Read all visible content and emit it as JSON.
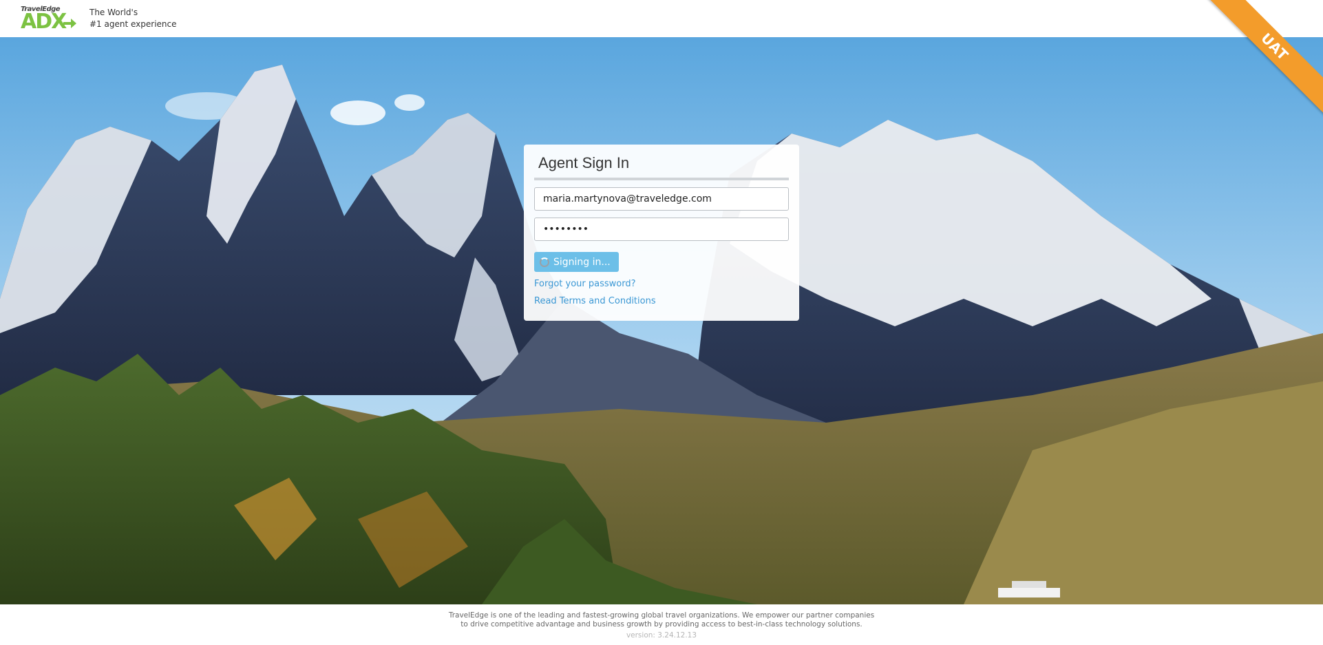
{
  "brand": {
    "logo_small": "TravelEdge",
    "logo_main": "ADX",
    "tagline_line1": "The World's",
    "tagline_line2": "#1 agent experience",
    "accent_color": "#7cc242"
  },
  "environment_ribbon": {
    "label": "UAT",
    "color": "#f39c2b"
  },
  "signin": {
    "title": "Agent Sign In",
    "email_value": "maria.martynova@traveledge.com",
    "password_value": "••••••••",
    "submit_label": "Signing in...",
    "forgot_link": "Forgot your password?",
    "terms_link": "Read Terms and Conditions",
    "button_color": "#6cbfe8",
    "link_color": "#3a97d4"
  },
  "footer": {
    "line1": "TravelEdge is one of the leading and fastest-growing global travel organizations. We empower our partner companies",
    "line2": "to drive competitive advantage and business growth by providing access to best-in-class technology solutions.",
    "version": "version: 3.24.12.13"
  }
}
